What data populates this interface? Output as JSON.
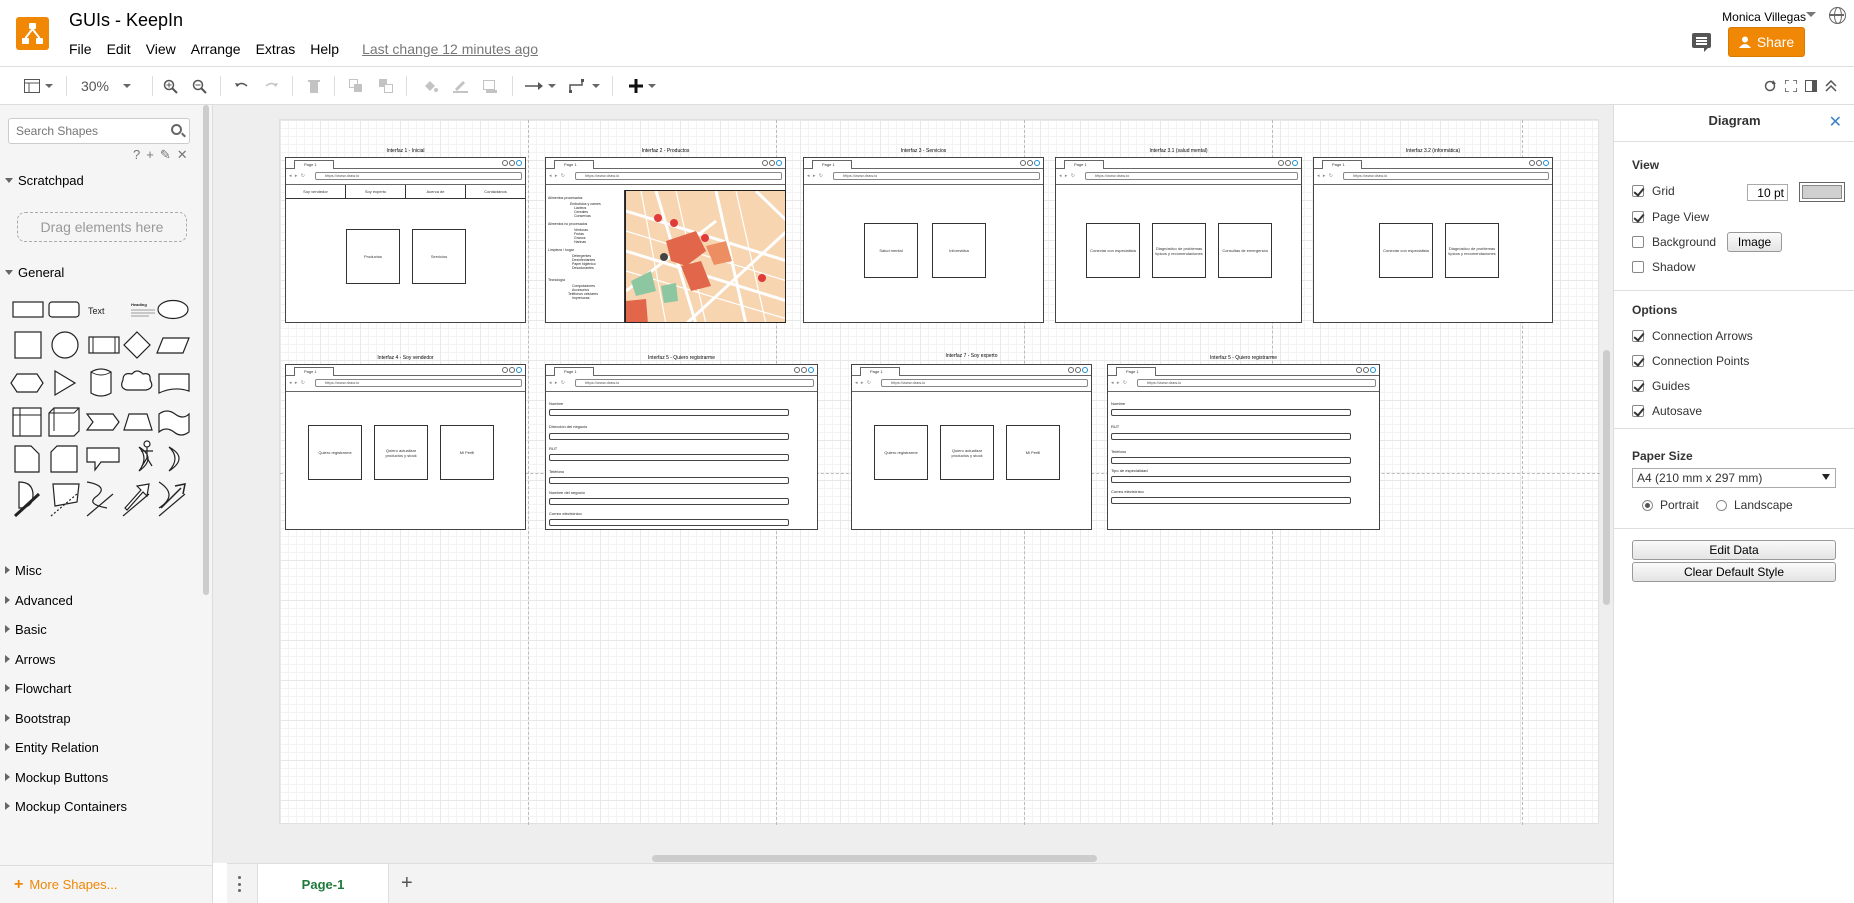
{
  "app": {
    "title": "GUIs - KeepIn",
    "last_change": "Last change 12 minutes ago",
    "user": "Monica Villegas",
    "share_label": "Share"
  },
  "menu": [
    "File",
    "Edit",
    "View",
    "Arrange",
    "Extras",
    "Help"
  ],
  "toolbar": {
    "zoom": "30%"
  },
  "sidebar": {
    "search_placeholder": "Search Shapes",
    "scratchpad": "Scratchpad",
    "scratch_tools": [
      "?",
      "+",
      "✎",
      "✕"
    ],
    "drag_here": "Drag elements here",
    "general": "General",
    "shape_text": "Text",
    "shape_heading": "Heading",
    "sections": [
      "Misc",
      "Advanced",
      "Basic",
      "Arrows",
      "Flowchart",
      "Bootstrap",
      "Entity Relation",
      "Mockup Buttons",
      "Mockup Containers"
    ],
    "more_shapes": "More Shapes..."
  },
  "canvas": {
    "mock_tab": "Page 1",
    "url": "https://www.draw.io",
    "row1": [
      {
        "title": "Interfaz 1 - Inicial",
        "nav": [
          "Soy vendedor",
          "Soy experto",
          "Acerca de",
          "Contáctanos"
        ],
        "boxes": [
          "Productos",
          "Servicios"
        ]
      },
      {
        "title": "Interfaz 2 - Productos"
      },
      {
        "title": "Interfaz 3 - Servicios",
        "boxes": [
          "Salud mental",
          "Informática"
        ]
      },
      {
        "title": "Interfaz 3.1 (salud mental)",
        "boxes": [
          "Conectar con especialista",
          "Diagnóstico de problemas típicos y recomendaciones",
          "Consultas de emergencia"
        ]
      },
      {
        "title": "Interfaz 3.2 (informática)",
        "boxes": [
          "Conectar con especialista",
          "Diagnóstico de problemas típicos y recomendaciones"
        ]
      }
    ],
    "row2": [
      {
        "title": "Interfaz 4 - Soy vendedor",
        "boxes": [
          "Quiero registrarme",
          "Quiero actualizar productos y stock",
          "Mi Perfil"
        ]
      },
      {
        "title": "Interfaz 5 - Quiero registrarme",
        "fields": [
          "Nombre",
          "Dirección del negocio",
          "RUT",
          "Teléfono",
          "Nombre del negocio",
          "Correo electrónico"
        ]
      },
      {
        "title": "Interfaz 7 - Soy experto",
        "boxes": [
          "Quiero registrarme",
          "Quiero actualizar productos y stock",
          "Mi Perfil"
        ]
      },
      {
        "title": "Interfaz 5 - Quiero registrarme",
        "fields": [
          "Nombre",
          "RUT",
          "Teléfono",
          "Tipo de especialidad",
          "Correo electrónico"
        ]
      }
    ],
    "products_categories": [
      {
        "head": "Alimentos procesados",
        "items": [
          "Embutidos y carnes",
          "Lácteos",
          "Cereales",
          "Conservas"
        ]
      },
      {
        "head": "Alimentos no procesados",
        "items": [
          "Verduras",
          "Frutas",
          "Granos",
          "Harinas"
        ]
      },
      {
        "head": "Limpieza / hogar",
        "items": [
          "Detergentes",
          "Desinfectantes",
          "Papel higiénico",
          "Desodorantes"
        ]
      },
      {
        "head": "Tecnología",
        "items": [
          "Computadores",
          "Accesorios",
          "Teléfonos celulares",
          "Impresoras"
        ]
      }
    ]
  },
  "bottom": {
    "page_tab": "Page-1"
  },
  "format_panel": {
    "title": "Diagram",
    "view_label": "View",
    "grid": "Grid",
    "grid_size": "10 pt",
    "page_view": "Page View",
    "background": "Background",
    "image_button": "Image",
    "shadow": "Shadow",
    "options_label": "Options",
    "connection_arrows": "Connection Arrows",
    "connection_points": "Connection Points",
    "guides": "Guides",
    "autosave": "Autosave",
    "paper_size_label": "Paper Size",
    "paper_size": "A4 (210 mm x 297 mm)",
    "portrait": "Portrait",
    "landscape": "Landscape",
    "edit_data": "Edit Data",
    "clear_style": "Clear Default Style"
  },
  "colors": {
    "brand": "#f08705",
    "page_tab_text": "#1f7a3a"
  }
}
